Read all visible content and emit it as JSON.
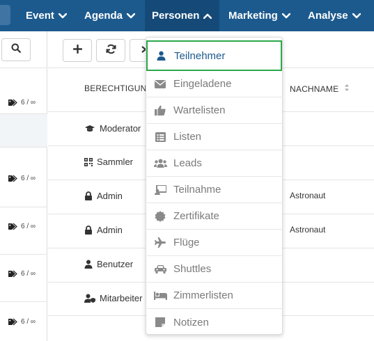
{
  "nav": {
    "items": [
      {
        "label": "Event"
      },
      {
        "label": "Agenda"
      },
      {
        "label": "Personen"
      },
      {
        "label": "Marketing"
      },
      {
        "label": "Analyse"
      }
    ],
    "active": "Personen"
  },
  "left_panel": {
    "counts": [
      "6 / ∞",
      "6 / ∞",
      "6 / ∞",
      "6 / ∞",
      "6 / ∞"
    ]
  },
  "table": {
    "headers": {
      "berechtigung": "BERECHTIGUN",
      "nachname": "NACHNAME"
    },
    "rows": [
      {
        "role": "Moderator",
        "last_name": ""
      },
      {
        "role": "Sammler",
        "last_name": ""
      },
      {
        "role": "Admin",
        "last_name": "Astronaut"
      },
      {
        "role": "Admin",
        "last_name": "Astronaut"
      },
      {
        "role": "Benutzer",
        "last_name": ""
      },
      {
        "role": "Mitarbeiter",
        "last_name": ""
      }
    ]
  },
  "dropdown": {
    "items": [
      {
        "label": "Teilnehmer",
        "icon": "user-icon"
      },
      {
        "label": "Eingeladene",
        "icon": "envelope-icon"
      },
      {
        "label": "Wartelisten",
        "icon": "thumbs-up-icon"
      },
      {
        "label": "Listen",
        "icon": "list-icon"
      },
      {
        "label": "Leads",
        "icon": "users-icon"
      },
      {
        "label": "Teilnahme",
        "icon": "check-in-icon"
      },
      {
        "label": "Zertifikate",
        "icon": "certificate-icon"
      },
      {
        "label": "Flüge",
        "icon": "plane-icon"
      },
      {
        "label": "Shuttles",
        "icon": "car-icon"
      },
      {
        "label": "Zimmerlisten",
        "icon": "bed-icon"
      },
      {
        "label": "Notizen",
        "icon": "sticky-note-icon"
      }
    ]
  },
  "colors": {
    "nav_bg": "#1c5a8e",
    "nav_active_bg": "#154a78",
    "active_text": "#1c5a8e",
    "highlight_border": "#2aa84a",
    "menu_text": "#7a7a7a"
  }
}
